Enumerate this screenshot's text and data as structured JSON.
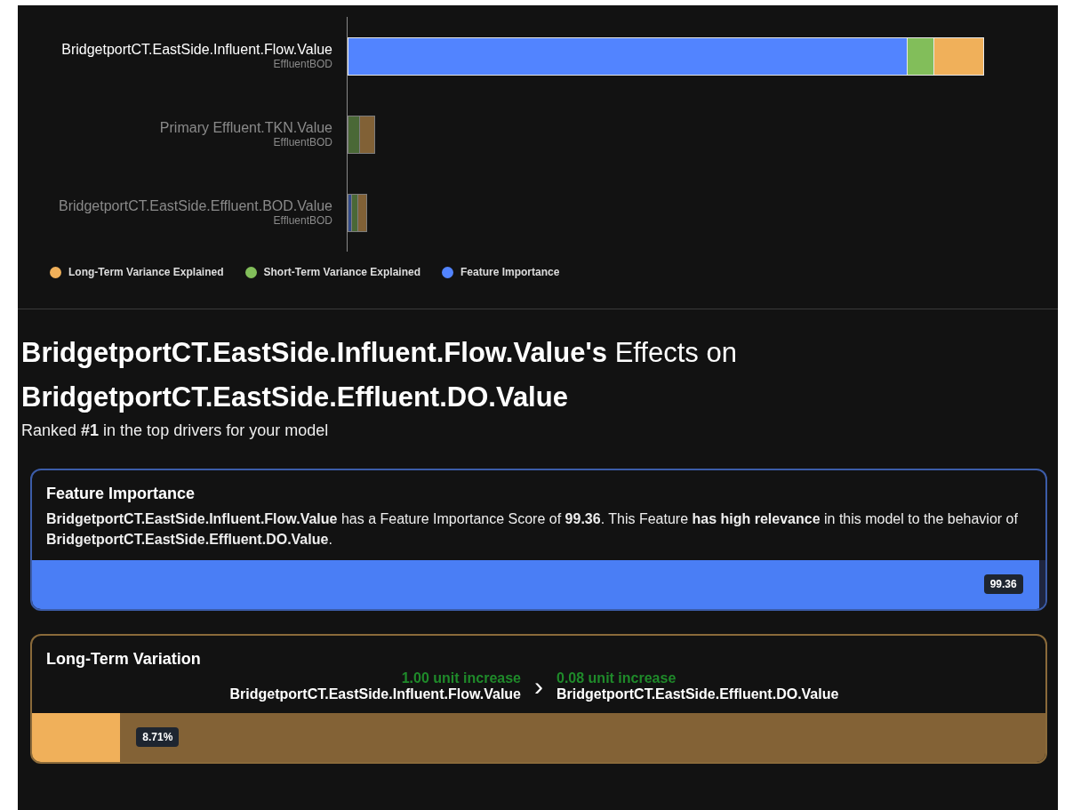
{
  "chart": {
    "rows": [
      {
        "label": "BridgetportCT.EastSide.Influent.Flow.Value",
        "sublabel": "EffluentBOD",
        "selected": true
      },
      {
        "label": "Primary Effluent.TKN.Value",
        "sublabel": "EffluentBOD",
        "selected": false
      },
      {
        "label": "BridgetportCT.EastSide.Effluent.BOD.Value",
        "sublabel": "EffluentBOD",
        "selected": false
      }
    ],
    "legend": [
      {
        "label": "Long-Term Variance Explained",
        "color": "#f0b05a"
      },
      {
        "label": "Short-Term Variance Explained",
        "color": "#82be5a"
      },
      {
        "label": "Feature Importance",
        "color": "#5284ff"
      }
    ]
  },
  "heading": "**BridgetportCT.EastSide.Influent.Flow.Value's** Effects on **BridgetportCT.EastSide.Effluent.DO.Value**",
  "subheading": "Ranked **#1** in the top drivers for your model",
  "feature_card": {
    "title": "Feature Importance",
    "text": "**BridgetportCT.EastSide.Influent.Flow.Value** has a Feature Importance Score of **99.36**. This Feature **has high relevance** in this model to the behavior of **BridgetportCT.EastSide.Effluent.DO.Value**.",
    "level": 0.9936,
    "value": "99.36"
  },
  "variation_card": {
    "title": "Long-Term Variation",
    "input_change": "1.00 unit increase",
    "input_name": "BridgetportCT.EastSide.Influent.Flow.Value",
    "arrow": "›",
    "output_change": "0.08 unit increase",
    "output_name": "BridgetportCT.EastSide.Effluent.DO.Value",
    "level": 0.0871,
    "value": "8.71%"
  }
}
